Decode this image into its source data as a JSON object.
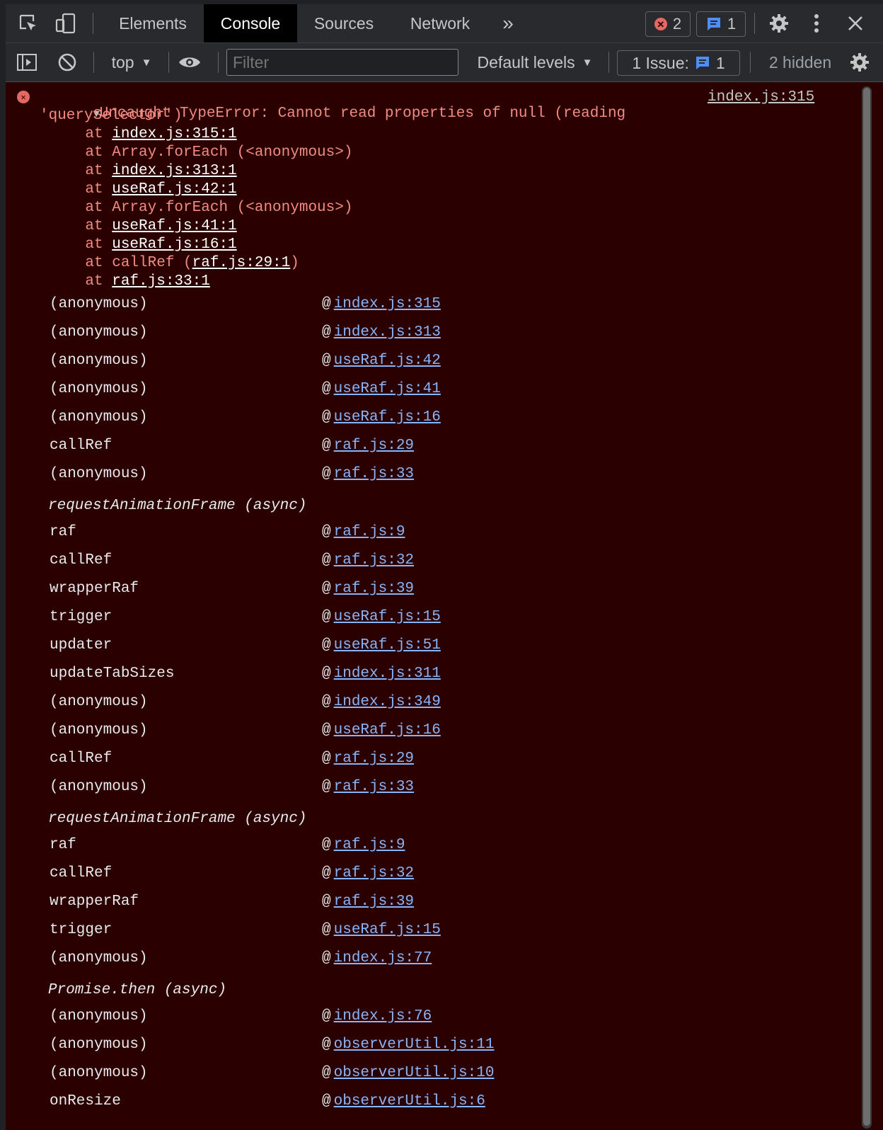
{
  "tabs": [
    {
      "label": "Elements"
    },
    {
      "label": "Console"
    },
    {
      "label": "Sources"
    },
    {
      "label": "Network"
    }
  ],
  "more_tabs": "»",
  "error_count": "2",
  "message_count": "1",
  "toolbar": {
    "context": "top",
    "filter_placeholder": "Filter",
    "levels": "Default levels",
    "issues_label": "1 Issue:",
    "issues_count": "1",
    "hidden": "2 hidden"
  },
  "error": {
    "line1": "Uncaught TypeError: Cannot read properties of null (reading",
    "line2": "'querySelector')",
    "source": "index.js:315",
    "stack": [
      {
        "prefix": "    at ",
        "link": "index.js:315:1",
        "suffix": ""
      },
      {
        "prefix": "    at Array.forEach (<anonymous>)",
        "link": "",
        "suffix": ""
      },
      {
        "prefix": "    at ",
        "link": "index.js:313:1",
        "suffix": ""
      },
      {
        "prefix": "    at ",
        "link": "useRaf.js:42:1",
        "suffix": ""
      },
      {
        "prefix": "    at Array.forEach (<anonymous>)",
        "link": "",
        "suffix": ""
      },
      {
        "prefix": "    at ",
        "link": "useRaf.js:41:1",
        "suffix": ""
      },
      {
        "prefix": "    at ",
        "link": "useRaf.js:16:1",
        "suffix": ""
      },
      {
        "prefix": "    at callRef (",
        "link": "raf.js:29:1",
        "suffix": ")"
      },
      {
        "prefix": "    at ",
        "link": "raf.js:33:1",
        "suffix": ""
      }
    ]
  },
  "trace_groups": [
    {
      "async": "",
      "rows": [
        {
          "fn": "(anonymous)",
          "loc": "index.js:315"
        },
        {
          "fn": "(anonymous)",
          "loc": "index.js:313"
        },
        {
          "fn": "(anonymous)",
          "loc": "useRaf.js:42"
        },
        {
          "fn": "(anonymous)",
          "loc": "useRaf.js:41"
        },
        {
          "fn": "(anonymous)",
          "loc": "useRaf.js:16"
        },
        {
          "fn": "callRef",
          "loc": "raf.js:29"
        },
        {
          "fn": "(anonymous)",
          "loc": "raf.js:33"
        }
      ]
    },
    {
      "async": "requestAnimationFrame (async)",
      "rows": [
        {
          "fn": "raf",
          "loc": "raf.js:9"
        },
        {
          "fn": "callRef",
          "loc": "raf.js:32"
        },
        {
          "fn": "wrapperRaf",
          "loc": "raf.js:39"
        },
        {
          "fn": "trigger",
          "loc": "useRaf.js:15"
        },
        {
          "fn": "updater",
          "loc": "useRaf.js:51"
        },
        {
          "fn": "updateTabSizes",
          "loc": "index.js:311"
        },
        {
          "fn": "(anonymous)",
          "loc": "index.js:349"
        },
        {
          "fn": "(anonymous)",
          "loc": "useRaf.js:16"
        },
        {
          "fn": "callRef",
          "loc": "raf.js:29"
        },
        {
          "fn": "(anonymous)",
          "loc": "raf.js:33"
        }
      ]
    },
    {
      "async": "requestAnimationFrame (async)",
      "rows": [
        {
          "fn": "raf",
          "loc": "raf.js:9"
        },
        {
          "fn": "callRef",
          "loc": "raf.js:32"
        },
        {
          "fn": "wrapperRaf",
          "loc": "raf.js:39"
        },
        {
          "fn": "trigger",
          "loc": "useRaf.js:15"
        },
        {
          "fn": "(anonymous)",
          "loc": "index.js:77"
        }
      ]
    },
    {
      "async": "Promise.then (async)",
      "rows": [
        {
          "fn": "(anonymous)",
          "loc": "index.js:76"
        },
        {
          "fn": "(anonymous)",
          "loc": "observerUtil.js:11"
        },
        {
          "fn": "(anonymous)",
          "loc": "observerUtil.js:10"
        },
        {
          "fn": "onResize",
          "loc": "observerUtil.js:6"
        }
      ]
    }
  ]
}
